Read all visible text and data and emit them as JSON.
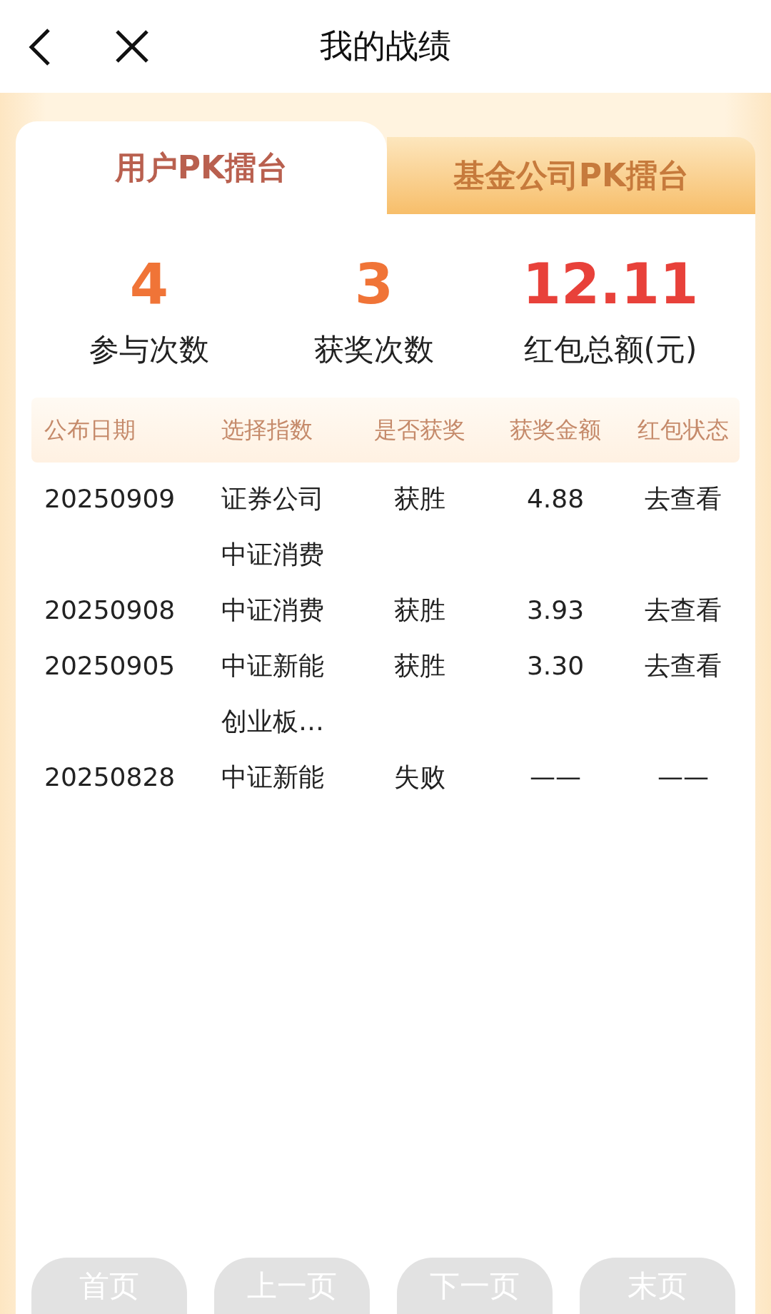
{
  "header": {
    "title": "我的战绩"
  },
  "tabs": [
    {
      "label": "用户PK擂台",
      "selected": true
    },
    {
      "label": "基金公司PK擂台",
      "selected": false
    }
  ],
  "stats": [
    {
      "value": "4",
      "label": "参与次数",
      "color": "#f07437"
    },
    {
      "value": "3",
      "label": "获奖次数",
      "color": "#f07437"
    },
    {
      "value": "12.11",
      "label": "红包总额(元)",
      "color": "#e8413a"
    }
  ],
  "table": {
    "columns": [
      "公布日期",
      "选择指数",
      "是否获奖",
      "获奖金额",
      "红包状态"
    ],
    "rows": [
      {
        "date": "20250909",
        "index": "证券公司中证消费",
        "result": "获胜",
        "amount": "4.88",
        "status": "去查看"
      },
      {
        "date": "20250908",
        "index": "中证消费",
        "result": "获胜",
        "amount": "3.93",
        "status": "去查看"
      },
      {
        "date": "20250905",
        "index": "中证新能创业板…",
        "result": "获胜",
        "amount": "3.30",
        "status": "去查看"
      },
      {
        "date": "20250828",
        "index": "中证新能",
        "result": "失败",
        "amount": "——",
        "status": "——"
      }
    ]
  },
  "pager": [
    {
      "label": "首页",
      "disabled": true
    },
    {
      "label": "上一页",
      "disabled": true
    },
    {
      "label": "下一页",
      "disabled": true
    },
    {
      "label": "末页",
      "disabled": true
    }
  ]
}
